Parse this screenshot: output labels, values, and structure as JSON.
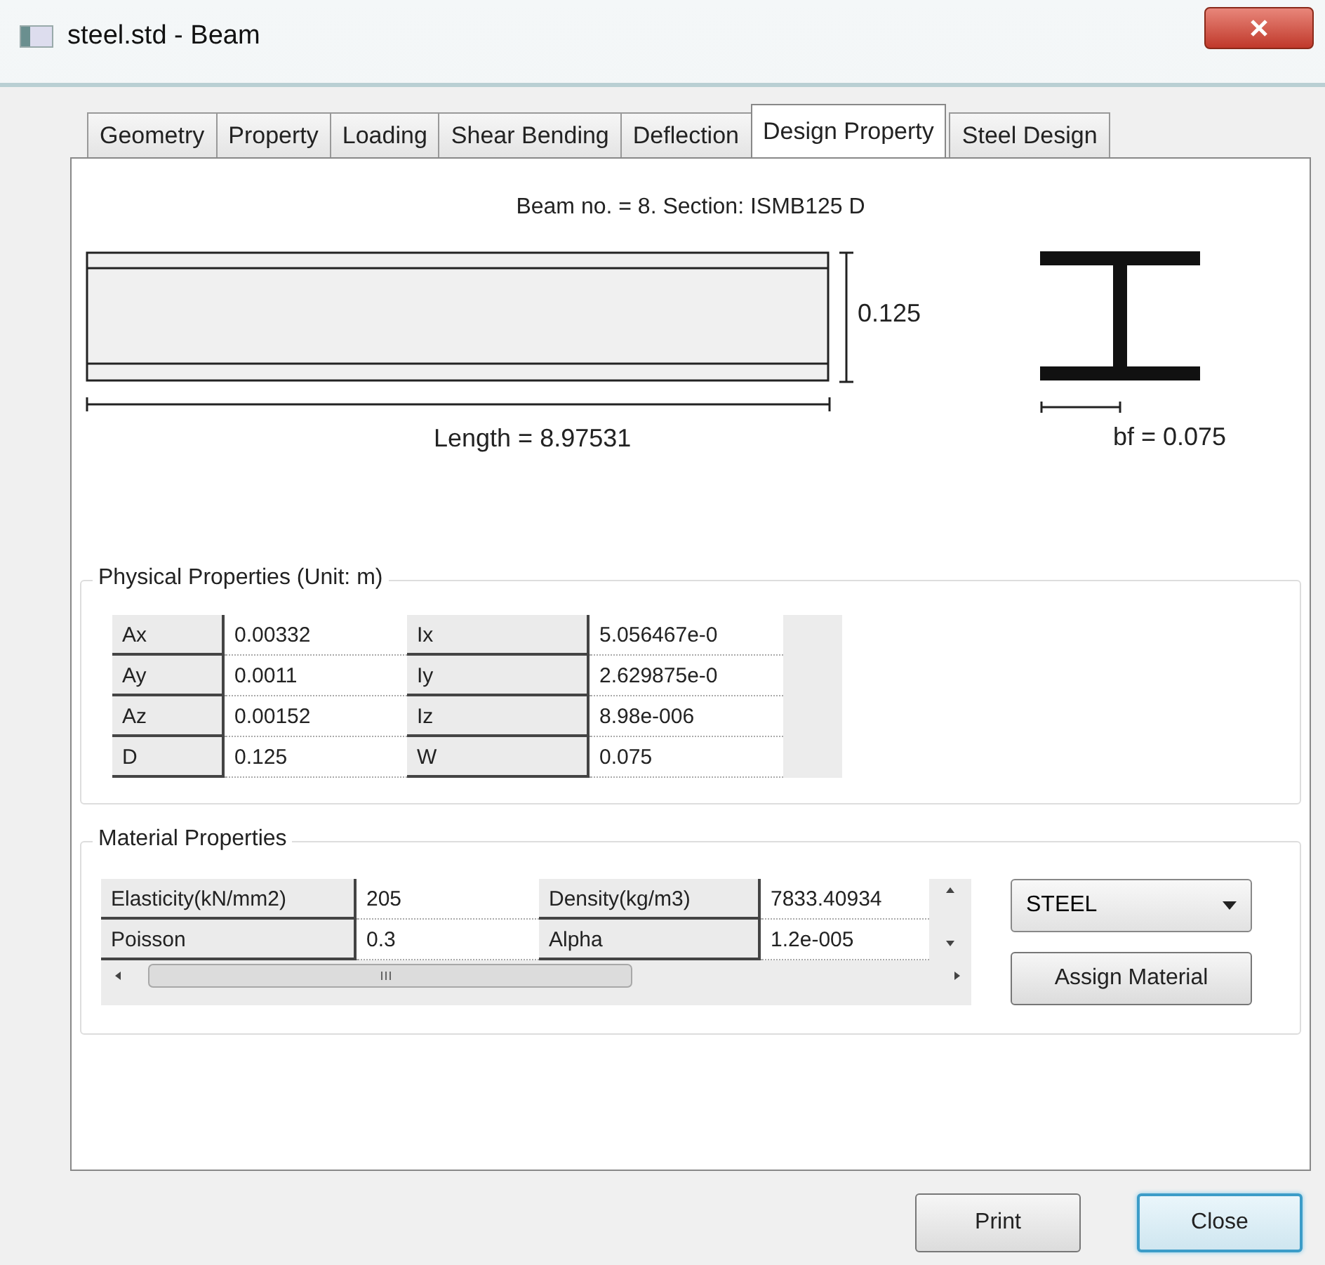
{
  "window": {
    "title": "steel.std - Beam"
  },
  "tabs": [
    {
      "label": "Geometry",
      "selected": false
    },
    {
      "label": "Property",
      "selected": false
    },
    {
      "label": "Loading",
      "selected": false
    },
    {
      "label": "Shear Bending",
      "selected": false
    },
    {
      "label": "Deflection",
      "selected": false
    },
    {
      "label": "Design Property",
      "selected": true
    },
    {
      "label": "Steel Design",
      "selected": false
    }
  ],
  "beam": {
    "caption": "Beam no. = 8. Section: ISMB125 D",
    "depth": "0.125",
    "length": "Length = 8.97531",
    "flange_width": "bf = 0.075"
  },
  "physical_properties": {
    "title": "Physical Properties (Unit: m)",
    "rows": [
      [
        "Ax",
        "0.00332",
        "Ix",
        "5.056467e-0"
      ],
      [
        "Ay",
        "0.0011",
        "Iy",
        "2.629875e-0"
      ],
      [
        "Az",
        "0.00152",
        "Iz",
        "8.98e-006"
      ],
      [
        "D",
        "0.125",
        "W",
        "0.075"
      ]
    ]
  },
  "material_properties": {
    "title": "Material Properties",
    "rows": [
      [
        "Elasticity(kN/mm2)",
        "205",
        "Density(kg/m3)",
        "7833.40934"
      ],
      [
        "Poisson",
        "0.3",
        "Alpha",
        "1.2e-005"
      ]
    ],
    "material": "STEEL",
    "assign_button": "Assign Material"
  },
  "buttons": [
    {
      "label": "Print",
      "default": false
    },
    {
      "label": "Close",
      "default": true
    }
  ]
}
